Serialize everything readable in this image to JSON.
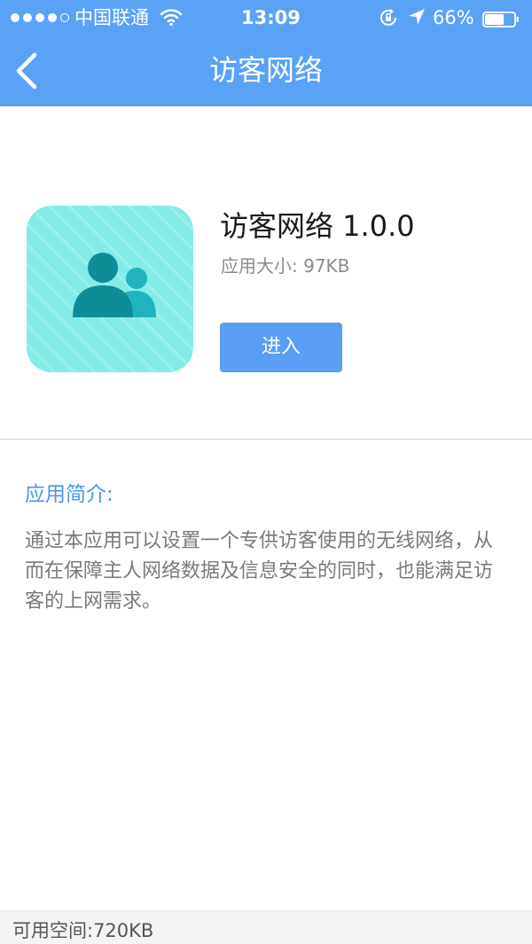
{
  "status_bar": {
    "carrier": "中国联通",
    "time": "13:09",
    "battery": "66%",
    "battery_level": 0.66
  },
  "nav": {
    "title": "访客网络",
    "back_icon": "chevron-left-icon"
  },
  "app": {
    "name": "访客网络 1.0.0",
    "size": "应用大小: 97KB",
    "enter_label": "进入",
    "icon": "users-icon",
    "icon_colors": {
      "background": "#84ebe6",
      "person_primary": "#0f8c98",
      "person_secondary": "#1fb3bd"
    }
  },
  "intro": {
    "heading": "应用简介:",
    "text": "通过本应用可以设置一个专供访客使用的无线网络，从而在保障主人网络数据及信息安全的同时，也能满足访客的上网需求。"
  },
  "footer": {
    "free_space": "可用空间:720KB"
  },
  "colors": {
    "header": "#5aa2f6",
    "button": "#5a9ef5",
    "heading": "#4a96e8"
  }
}
